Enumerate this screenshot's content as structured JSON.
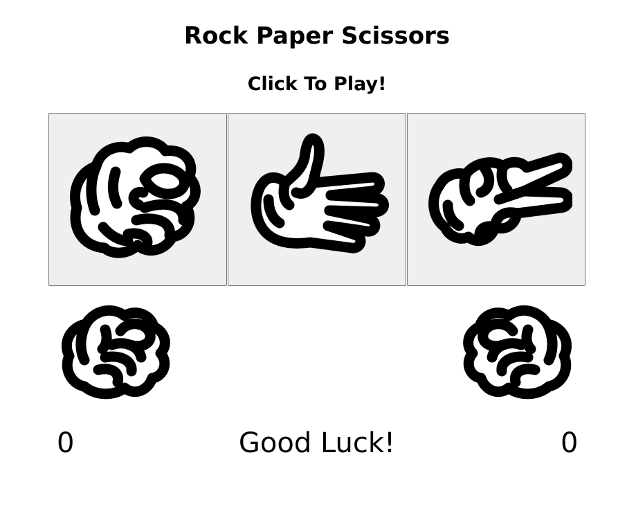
{
  "title": "Rock Paper Scissors",
  "subtitle": "Click To Play!",
  "choices": [
    {
      "label": "rock",
      "icon": "fist-icon"
    },
    {
      "label": "paper",
      "icon": "open-hand-icon"
    },
    {
      "label": "scissors",
      "icon": "scissors-hand-icon"
    }
  ],
  "player": {
    "hand_icon": "fist-icon",
    "score": "0"
  },
  "computer": {
    "hand_icon": "fist-icon",
    "score": "0"
  },
  "message": "Good Luck!"
}
